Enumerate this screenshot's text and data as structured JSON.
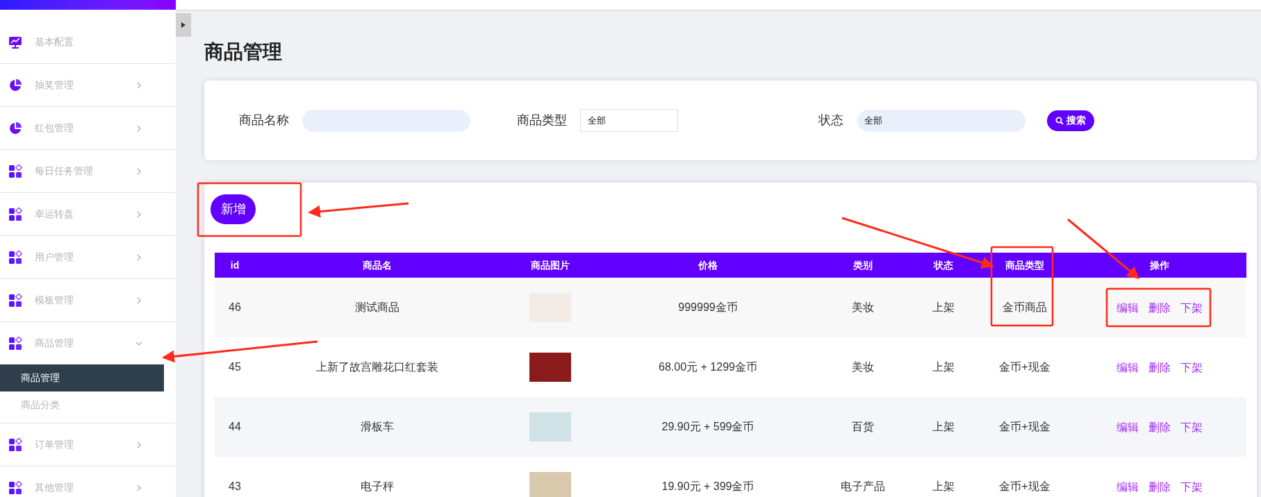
{
  "sidebar": {
    "items": [
      {
        "label": "基本配置",
        "kind": "monitor"
      },
      {
        "label": "抽奖管理",
        "kind": "pie",
        "expanded": false
      },
      {
        "label": "红包管理",
        "kind": "pie",
        "expanded": false
      },
      {
        "label": "每日任务管理",
        "kind": "apps",
        "expanded": false
      },
      {
        "label": "幸运转盘",
        "kind": "apps",
        "expanded": false
      },
      {
        "label": "用户管理",
        "kind": "apps",
        "expanded": false
      },
      {
        "label": "模板管理",
        "kind": "apps",
        "expanded": false
      },
      {
        "label": "商品管理",
        "kind": "apps",
        "expanded": true,
        "children": [
          {
            "label": "商品管理",
            "selected": true
          },
          {
            "label": "商品分类",
            "selected": false
          }
        ]
      },
      {
        "label": "订单管理",
        "kind": "apps",
        "expanded": false
      },
      {
        "label": "其他管理",
        "kind": "apps",
        "expanded": false
      }
    ]
  },
  "page_title": "商品管理",
  "search": {
    "name_label": "商品名称",
    "type_label": "商品类型",
    "type_value": "全部",
    "status_label": "状态",
    "status_value": "全部",
    "button": "搜索"
  },
  "add_button": "新增",
  "table": {
    "columns": [
      "id",
      "商品名",
      "商品图片",
      "价格",
      "类别",
      "状态",
      "商品类型",
      "操作"
    ],
    "rows": [
      {
        "id": "46",
        "name": "测试商品",
        "price": "999999金币",
        "category": "美妆",
        "status": "上架",
        "type": "金币商品",
        "actions": [
          "编辑",
          "删除",
          "下架"
        ]
      },
      {
        "id": "45",
        "name": "上新了故宫雕花口红套装",
        "price": "68.00元 + 1299金币",
        "category": "美妆",
        "status": "上架",
        "type": "金币+现金",
        "actions": [
          "编辑",
          "删除",
          "下架"
        ]
      },
      {
        "id": "44",
        "name": "滑板车",
        "price": "29.90元 + 599金币",
        "category": "百货",
        "status": "上架",
        "type": "金币+现金",
        "actions": [
          "编辑",
          "删除",
          "下架"
        ]
      },
      {
        "id": "43",
        "name": "电子秤",
        "price": "19.90元 + 399金币",
        "category": "电子产品",
        "status": "上架",
        "type": "金币+现金",
        "actions": [
          "编辑",
          "删除",
          "下架"
        ]
      }
    ]
  }
}
